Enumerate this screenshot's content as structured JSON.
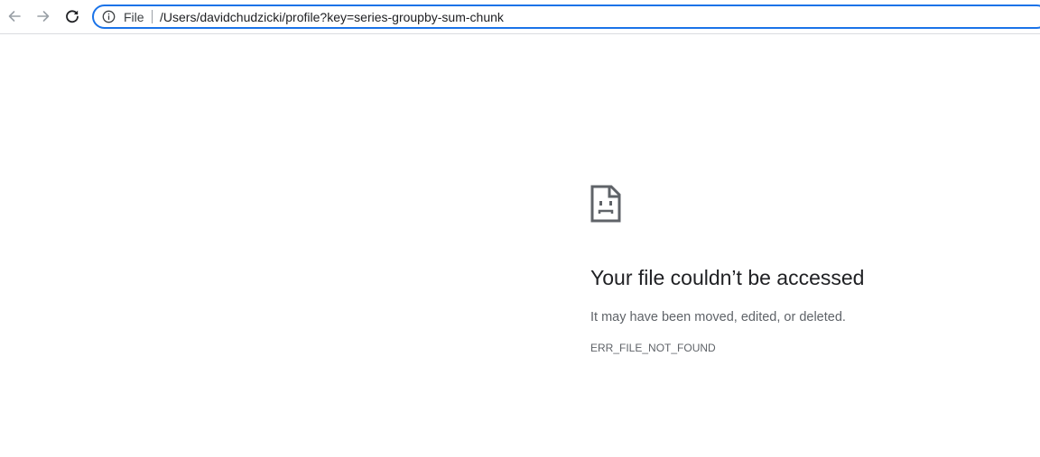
{
  "toolbar": {
    "icons": {
      "back": "arrow-left-icon",
      "forward": "arrow-right-icon",
      "reload": "reload-icon",
      "info": "info-icon"
    },
    "omnibox": {
      "scheme_label": "File",
      "url": "/Users/davidchudzicki/profile?key=series-groupby-sum-chunk"
    }
  },
  "error_page": {
    "icon": "sad-file-icon",
    "title": "Your file couldn’t be accessed",
    "message": "It may have been moved, edited, or deleted.",
    "code": "ERR_FILE_NOT_FOUND"
  },
  "colors": {
    "focus_ring": "#1a73e8",
    "text_primary": "#202124",
    "text_secondary": "#5f6368",
    "icon_disabled": "#9aa0a6",
    "icon_active": "#202124"
  }
}
